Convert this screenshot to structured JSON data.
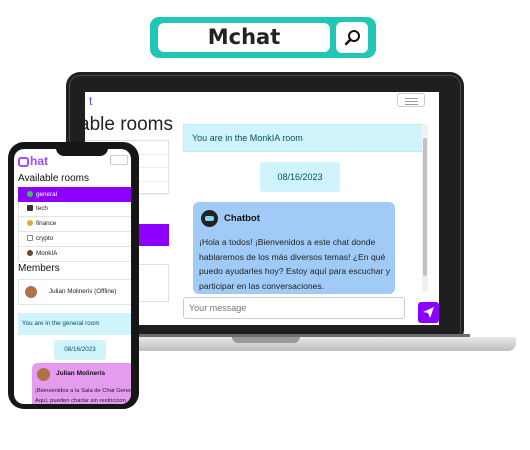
{
  "header": {
    "title": "Mchat",
    "search_icon": "search-icon"
  },
  "laptop": {
    "logo": "t",
    "rooms_title": "able rooms",
    "room_banner": "You are in the MonkIA room",
    "date": "08/16/2023",
    "message": {
      "sender": "Chatbot",
      "text": "¡Hola a todos! ¡Bienvenidos a este chat donde hablaremos de los más diversos temas! ¿En qué puedo ayudarles hoy? Estoy aquí para escuchar y participar en las conversaciones."
    },
    "input_placeholder": "Your message",
    "send_icon": "paper-plane-icon"
  },
  "phone": {
    "logo": "hat",
    "rooms_title": "Available rooms",
    "rooms": [
      {
        "label": "general",
        "icon": "green-dot-icon",
        "active": true
      },
      {
        "label": "tech",
        "icon": "laptop-icon",
        "active": false
      },
      {
        "label": "finance",
        "icon": "money-bag-icon",
        "active": false
      },
      {
        "label": "crypto",
        "icon": "chart-icon",
        "active": false
      },
      {
        "label": "MonkIA",
        "icon": "monkey-icon",
        "active": false
      }
    ],
    "members_title": "Members",
    "members": [
      {
        "label": "Julian Molineris (Offline)"
      }
    ],
    "room_banner": "You are in the general room",
    "date": "08/16/2023",
    "message": {
      "sender": "Julian Molineris",
      "line1": "¡Bienvenidos a la Sala de Chat Gener",
      "line2": "Aquí, pueden charlar sin restriccion"
    }
  },
  "colors": {
    "accent": "#8b00ff",
    "header_teal": "#21c6b4",
    "info_bg": "#cff4fc",
    "bot_bubble": "#a0cbf7",
    "user_bubble": "#e59cf0"
  }
}
